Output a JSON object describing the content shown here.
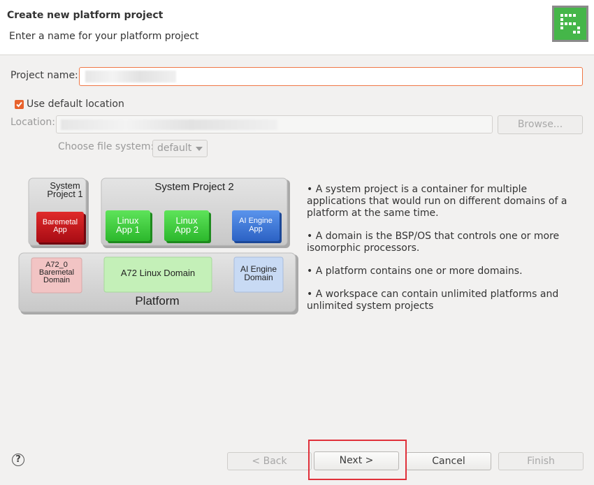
{
  "header": {
    "title": "Create new platform project",
    "subtitle": "Enter a name for your platform project",
    "logo_icon": "platform-logo-icon"
  },
  "form": {
    "project_name_label": "Project name:",
    "project_name_value": "",
    "use_default_location_label": "Use default location",
    "use_default_location_checked": true,
    "location_label": "Location:",
    "location_value": "",
    "browse_label": "Browse...",
    "file_system_label": "Choose file system:",
    "file_system_value": "default"
  },
  "diagram": {
    "system_project_1": "System\nProject 1",
    "system_project_2": "System Project 2",
    "baremetal_app": "Baremetal\nApp",
    "linux_app_1": "Linux\nApp 1",
    "linux_app_2": "Linux\nApp 2",
    "ai_engine_app": "AI Engine\nApp",
    "a72_0_domain": "A72_0\nBaremetal\nDomain",
    "a72_linux_domain": "A72 Linux Domain",
    "ai_engine_domain": "AI Engine\nDomain",
    "platform": "Platform",
    "colors": {
      "red": "#c8141e",
      "green": "#3ed23e",
      "blue": "#3c78dc",
      "light_red": "#f2c4c4",
      "light_green": "#c4f0b8",
      "light_blue": "#c8daf4",
      "gray": "#d6d6d6"
    }
  },
  "bullets": [
    "• A system project is a container for multiple applications that would run on different domains of a platform at the same time.",
    "• A domain is the BSP/OS that controls one or more isomorphic processors.",
    "• A platform contains one or more domains.",
    "• A workspace can contain unlimited platforms and unlimited system projects"
  ],
  "footer": {
    "back_label": "< Back",
    "next_label": "Next >",
    "cancel_label": "Cancel",
    "finish_label": "Finish",
    "help_icon": "help-icon"
  }
}
